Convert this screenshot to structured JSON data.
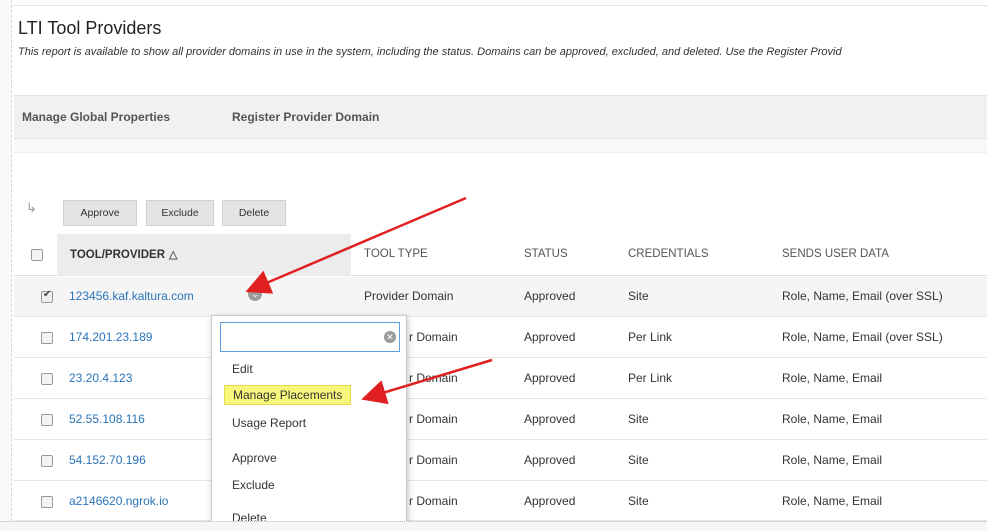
{
  "page": {
    "title": "LTI Tool Providers",
    "description": "This report is available to show all provider domains in use in the system, including the status. Domains can be approved, excluded, and deleted. Use the Register Provid"
  },
  "actions": {
    "manage_global": "Manage Global Properties",
    "register_domain": "Register Provider Domain"
  },
  "bulk": {
    "approve": "Approve",
    "exclude": "Exclude",
    "delete": "Delete"
  },
  "table": {
    "headers": [
      "TOOL/PROVIDER",
      "TOOL TYPE",
      "STATUS",
      "CREDENTIALS",
      "SENDS USER DATA"
    ],
    "sorted_column": "TOOL/PROVIDER",
    "sort_icon": "sort-ascending-icon",
    "rows": [
      {
        "provider": "123456.kaf.kaltura.com",
        "type": "Provider Domain",
        "status": "Approved",
        "credentials": "Site",
        "user_data": "Role, Name, Email (over SSL)",
        "checked": true
      },
      {
        "provider": "174.201.23.189",
        "type": "r Domain",
        "status": "Approved",
        "credentials": "Per Link",
        "user_data": "Role, Name, Email (over SSL)",
        "checked": false
      },
      {
        "provider": "23.20.4.123",
        "type": "r Domain",
        "status": "Approved",
        "credentials": "Per Link",
        "user_data": "Role, Name, Email",
        "checked": false
      },
      {
        "provider": "52.55.108.116",
        "type": "r Domain",
        "status": "Approved",
        "credentials": "Site",
        "user_data": "Role, Name, Email",
        "checked": false
      },
      {
        "provider": "54.152.70.196",
        "type": "r Domain",
        "status": "Approved",
        "credentials": "Site",
        "user_data": "Role, Name, Email",
        "checked": false
      },
      {
        "provider": "a2146620.ngrok.io",
        "type": "r Domain",
        "status": "Approved",
        "credentials": "Site",
        "user_data": "Role, Name, Email",
        "checked": false
      }
    ]
  },
  "context_menu": {
    "search_value": "",
    "search_placeholder": "",
    "items": [
      "Edit",
      "Manage Placements",
      "Usage Report",
      "Approve",
      "Exclude",
      "Delete"
    ],
    "highlighted": "Manage Placements"
  },
  "colors": {
    "link": "#2a74b8",
    "highlight": "#f7f77c",
    "annotation_arrow": "#e02020",
    "focus_border": "#5c9ee0"
  }
}
